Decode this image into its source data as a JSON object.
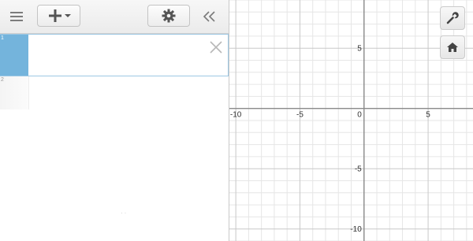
{
  "toolbar": {
    "menu_icon": "hamburger-icon",
    "add_icon": "plus-icon",
    "settings_icon": "gear-icon",
    "collapse_icon": "double-chevron-left-icon"
  },
  "expressions": [
    {
      "number": "1",
      "value": "",
      "selected": true
    },
    {
      "number": "2",
      "value": "",
      "selected": false
    }
  ],
  "graph": {
    "x_ticks": [
      "-10",
      "-5",
      "0",
      "5"
    ],
    "y_ticks": [
      "5",
      "-5",
      "-10"
    ],
    "x_range": [
      -10.5,
      8.5
    ],
    "y_range": [
      -11,
      9
    ],
    "grid": true,
    "tools": {
      "wrench_icon": "wrench-icon",
      "home_icon": "home-icon"
    }
  },
  "colors": {
    "selected_tab": "#74b4dc",
    "grid_minor": "#e6e6e6",
    "grid_major": "#c8c8c8",
    "axis": "#8a8a8a"
  }
}
